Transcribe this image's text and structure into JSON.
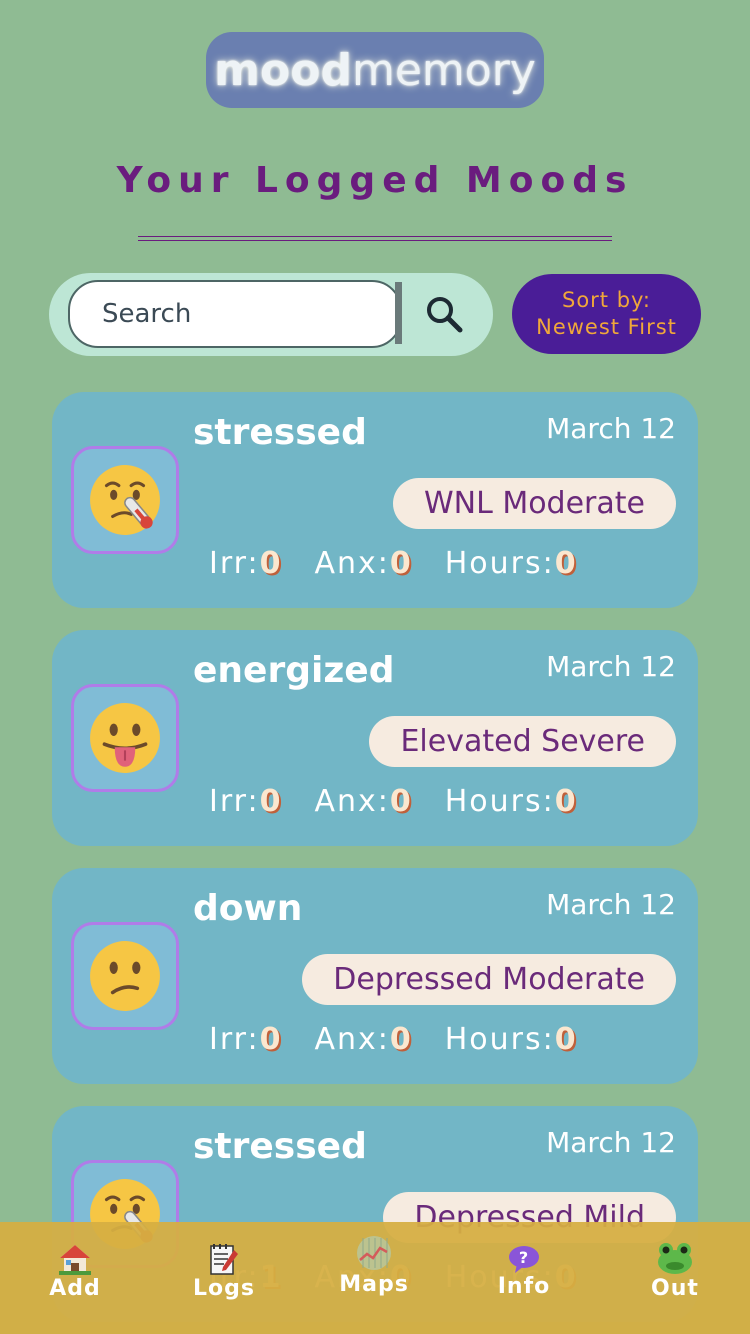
{
  "app": {
    "logo_bold": "mood",
    "logo_light": "memory"
  },
  "header": {
    "title": "Your Logged Moods"
  },
  "search": {
    "placeholder": "Search"
  },
  "sort": {
    "line1": "Sort by:",
    "line2": "Newest First"
  },
  "entries": [
    {
      "mood": "stressed",
      "date": "March 12",
      "badge": "WNL Moderate",
      "irr_label": "Irr:",
      "irr": "0",
      "anx_label": "Anx:",
      "anx": "0",
      "hours_label": "Hours:",
      "hours": "0",
      "emoji": "thermometer-face-icon"
    },
    {
      "mood": "energized",
      "date": "March 12",
      "badge": "Elevated Severe",
      "irr_label": "Irr:",
      "irr": "0",
      "anx_label": "Anx:",
      "anx": "0",
      "hours_label": "Hours:",
      "hours": "0",
      "emoji": "tongue-out-face-icon"
    },
    {
      "mood": "down",
      "date": "March 12",
      "badge": "Depressed Moderate",
      "irr_label": "Irr:",
      "irr": "0",
      "anx_label": "Anx:",
      "anx": "0",
      "hours_label": "Hours:",
      "hours": "0",
      "emoji": "confused-face-icon"
    },
    {
      "mood": "stressed",
      "date": "March 12",
      "badge": "Depressed Mild",
      "irr_label": "Irr:",
      "irr": "1",
      "anx_label": "Anx:",
      "anx": "0",
      "hours_label": "Hours:",
      "hours": "0",
      "emoji": "thermometer-face-icon"
    }
  ],
  "nav": {
    "add": "Add",
    "logs": "Logs",
    "maps": "Maps",
    "info": "Info",
    "out": "Out"
  },
  "colors": {
    "background": "#8fbb93",
    "card": "#72b6c6",
    "title": "#6a1c7e",
    "sort_bg": "#4a1d97",
    "sort_text": "#f0a73a",
    "navbar": "#d6ae42"
  }
}
